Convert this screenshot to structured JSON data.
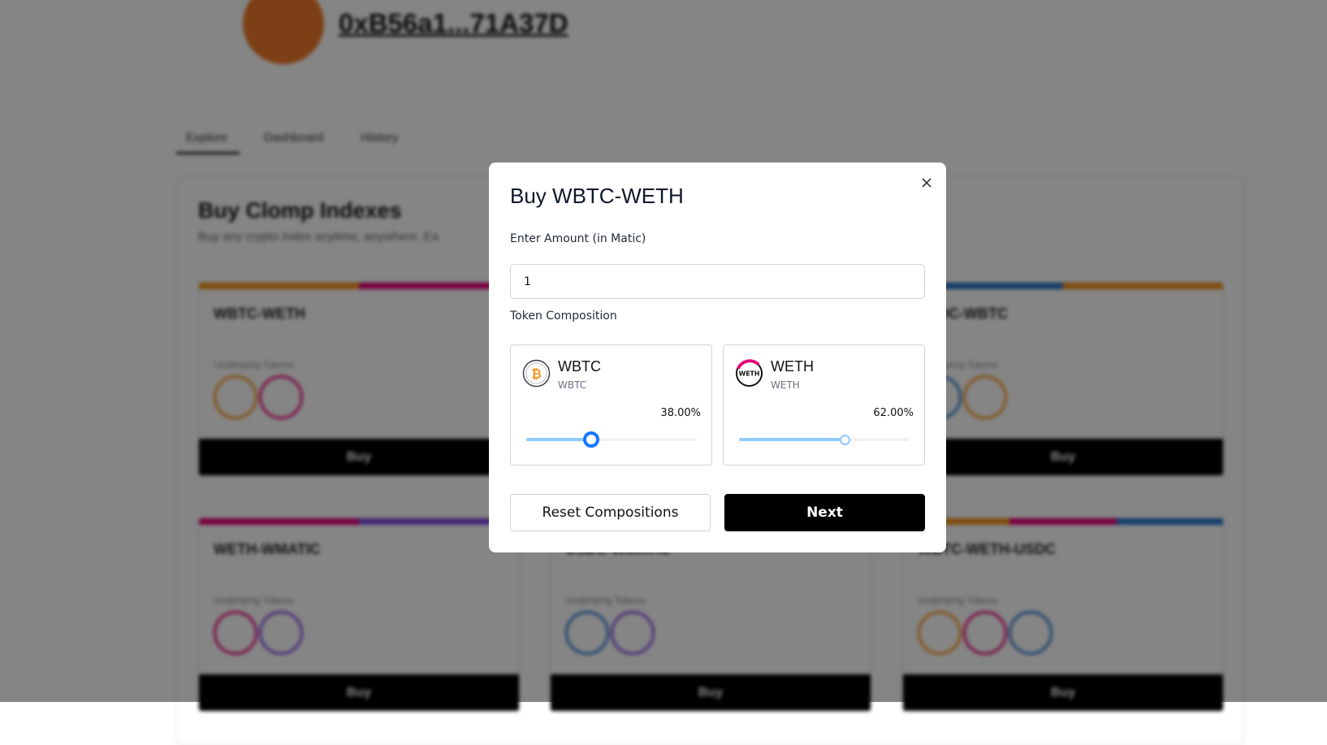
{
  "background": {
    "address": "0xB56a1...71A37D",
    "tabs": [
      "Explore",
      "Dashboard",
      "History"
    ],
    "heading": "Buy Clomp Indexes",
    "subheading": "Buy any crypto index anytime, anywhere. Ea",
    "underlying_label": "Underlying Tokens",
    "buy_label": "Buy",
    "cards": [
      {
        "name": "WBTC-WETH",
        "colors": [
          "#f7931a",
          "#e6007a"
        ],
        "coins": [
          "#f7931a",
          "#e6007a"
        ]
      },
      {
        "name": "",
        "colors": [
          "#e6007a",
          "#f7931a"
        ],
        "coins": []
      },
      {
        "name": "USDC-WBTC",
        "colors": [
          "#2775ca",
          "#f7931a"
        ],
        "coins": [
          "#2775ca",
          "#f7931a"
        ]
      },
      {
        "name": "WETH-WMATIC",
        "colors": [
          "#e6007a",
          "#8247e5"
        ],
        "coins": [
          "#e6007a",
          "#8247e5"
        ]
      },
      {
        "name": "USDC-WMATIC",
        "colors": [
          "#2775ca",
          "#8247e5"
        ],
        "coins": [
          "#2775ca",
          "#8247e5"
        ]
      },
      {
        "name": "WBTC-WETH-USDC",
        "colors": [
          "#f7931a",
          "#e6007a",
          "#2775ca"
        ],
        "coins": [
          "#f7931a",
          "#e6007a",
          "#2775ca"
        ]
      }
    ]
  },
  "modal": {
    "title": "Buy WBTC-WETH",
    "amount_label": "Enter Amount (in Matic)",
    "amount_value": "1",
    "composition_label": "Token Composition",
    "tokens": [
      {
        "name": "WBTC",
        "symbol": "WBTC",
        "percent_text": "38.00%",
        "percent": 38,
        "icon": "bitcoin-icon"
      },
      {
        "name": "WETH",
        "symbol": "WETH",
        "percent_text": "62.00%",
        "percent": 62,
        "icon": "weth-icon"
      }
    ],
    "reset_label": "Reset Compositions",
    "next_label": "Next"
  },
  "colors": {
    "accent": "#1677ff",
    "slider_fill": "#91caff",
    "primary_button": "#000000"
  }
}
